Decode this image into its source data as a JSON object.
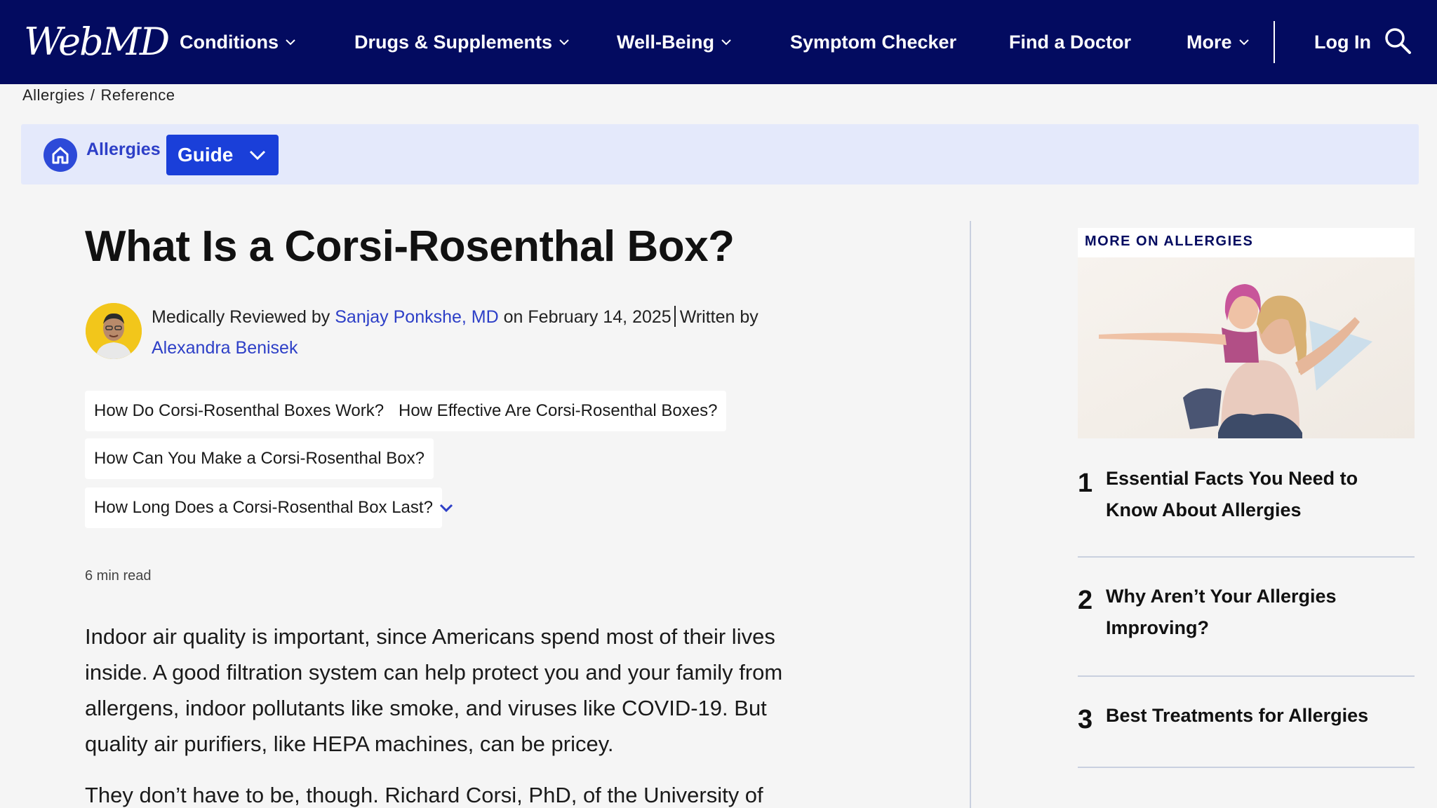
{
  "header": {
    "logo": "WebMD",
    "nav": [
      {
        "label": "Conditions",
        "dropdown": true
      },
      {
        "label": "Drugs & Supplements",
        "dropdown": true
      },
      {
        "label": "Well-Being",
        "dropdown": true
      },
      {
        "label": "Symptom Checker",
        "dropdown": false
      },
      {
        "label": "Find a Doctor",
        "dropdown": false
      },
      {
        "label": "More",
        "dropdown": true
      }
    ],
    "login": "Log In",
    "search_icon": "search-icon"
  },
  "breadcrumb": {
    "items": [
      "Allergies",
      "Reference"
    ],
    "separator": "/"
  },
  "topic_bar": {
    "home_icon": "home-icon",
    "topic": "Allergies",
    "guide_label": "Guide"
  },
  "article": {
    "title": "What Is a Corsi-Rosenthal Box?",
    "byline": {
      "reviewed_prefix": "Medically Reviewed by",
      "reviewer": "Sanjay Ponkshe, MD",
      "date_text": "on February 14, 2025",
      "written_prefix": "Written by",
      "author": "Alexandra Benisek"
    },
    "toc": [
      "How Do Corsi-Rosenthal Boxes Work?",
      "How Effective Are Corsi-Rosenthal Boxes?",
      "How Can You Make a Corsi-Rosenthal Box?",
      "How Long Does a Corsi-Rosenthal Box Last?"
    ],
    "read_time": "6 min read",
    "paragraphs": [
      "Indoor air quality is important, since Americans spend most of their lives inside. A good filtration system can help protect you and your family from allergens, indoor pollutants like smoke, and viruses like COVID-19. But quality air purifiers, like HEPA machines, can be pricey.",
      "They don’t have to be, though. Richard Corsi, PhD, of the University of"
    ]
  },
  "sidebar": {
    "label": "MORE ON ALLERGIES",
    "items": [
      {
        "num": "1",
        "title": "Essential Facts You Need to Know About Allergies"
      },
      {
        "num": "2",
        "title": "Why Aren’t Your Allergies Improving?"
      },
      {
        "num": "3",
        "title": "Best Treatments for Allergies"
      }
    ]
  },
  "colors": {
    "nav_bg": "#030b60",
    "accent": "#1a3fd9",
    "link": "#2d3fc7",
    "topic_bar_bg": "#e4e9fb"
  }
}
